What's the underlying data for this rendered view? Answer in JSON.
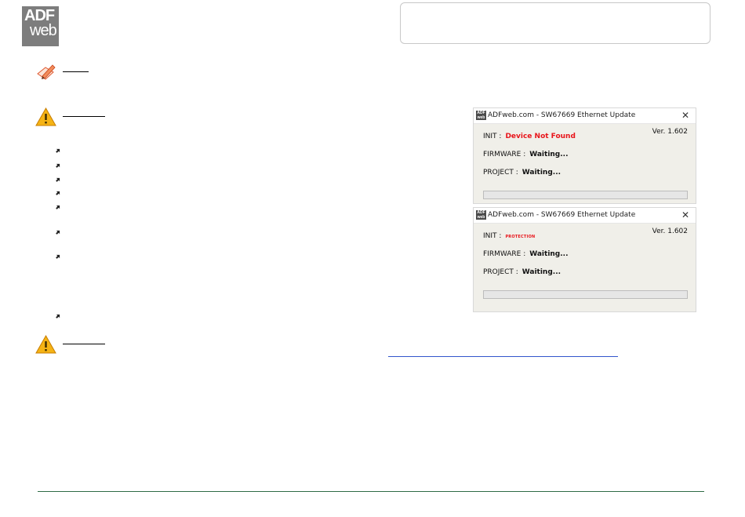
{
  "logo": {
    "line1": "ADF",
    "line2": "web"
  },
  "icons": {
    "note": "pencil-note-icon",
    "warning": "warning-triangle-icon",
    "bullet": "arrow-bullet-icon"
  },
  "dialogs": [
    {
      "title": "ADFweb.com - SW67669 Ethernet Update",
      "version": "Ver. 1.602",
      "init_label": "INIT :",
      "init_value": "Device Not Found",
      "firmware_label": "FIRMWARE :",
      "firmware_value": "Waiting...",
      "project_label": "PROJECT :",
      "project_value": "Waiting...",
      "progress": 0
    },
    {
      "title": "ADFweb.com - SW67669 Ethernet Update",
      "version": "Ver. 1.602",
      "init_label": "INIT :",
      "init_value": "PROTECTION",
      "firmware_label": "FIRMWARE :",
      "firmware_value": "Waiting...",
      "project_label": "PROJECT :",
      "project_value": "Waiting...",
      "progress": 0
    }
  ],
  "colors": {
    "error_red": "#e8141a",
    "footer_rule": "#2e6b45",
    "link_blue": "#3355cc",
    "dialog_bg": "#f0efe9"
  }
}
